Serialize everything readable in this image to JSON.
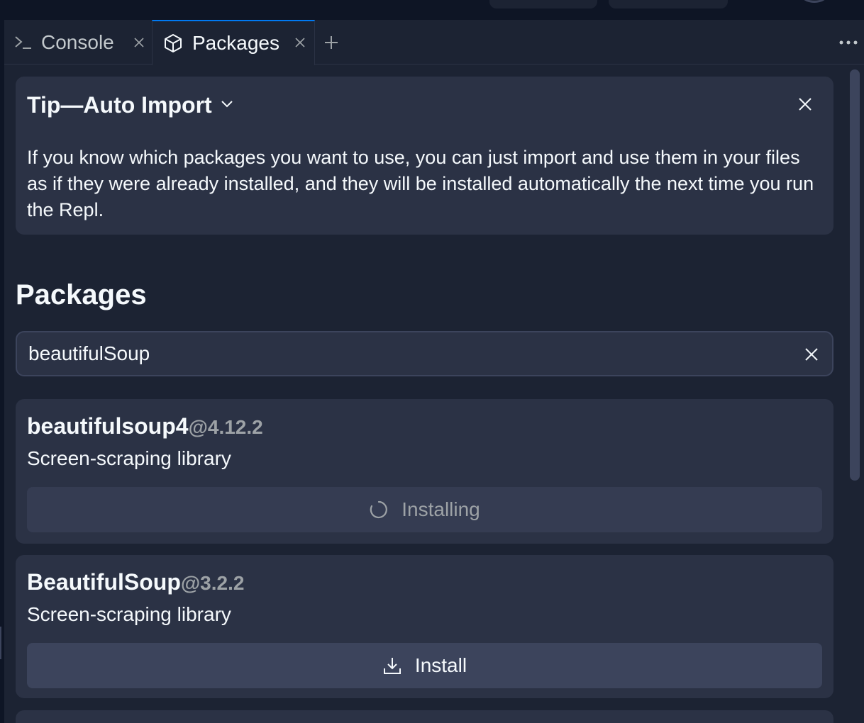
{
  "tabs": [
    {
      "label": "Console",
      "icon": "terminal-icon",
      "active": false
    },
    {
      "label": "Packages",
      "icon": "package-icon",
      "active": true
    }
  ],
  "tip": {
    "title": "Tip—Auto Import",
    "body": "If you know which packages you want to use, you can just import and use them in your files as if they were already installed, and they will be installed automatically the next time you run the Repl."
  },
  "packages_section": {
    "title": "Packages",
    "search_value": "beautifulSoup"
  },
  "results": [
    {
      "name": "beautifulsoup4",
      "version": "@4.12.2",
      "description": "Screen-scraping library",
      "action_label": "Installing",
      "state": "installing"
    },
    {
      "name": "BeautifulSoup",
      "version": "@3.2.2",
      "description": "Screen-scraping library",
      "action_label": "Install",
      "state": "install"
    }
  ],
  "colors": {
    "accent": "#0079f2",
    "panel": "#1c2333",
    "card": "#2b3245",
    "button": "#3c445c"
  }
}
